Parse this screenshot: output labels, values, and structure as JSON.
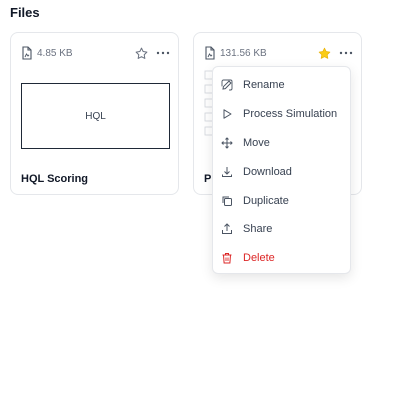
{
  "section_title": "Files",
  "cards": [
    {
      "size": "4.85 KB",
      "preview_text": "HQL",
      "title": "HQL Scoring",
      "starred": false
    },
    {
      "size": "131.56 KB",
      "title_visible": "P",
      "starred": true
    }
  ],
  "menu": {
    "items": [
      {
        "label": "Rename",
        "icon": "pencil-icon"
      },
      {
        "label": "Process Simulation",
        "icon": "play-icon"
      },
      {
        "label": "Move",
        "icon": "move-icon"
      },
      {
        "label": "Download",
        "icon": "download-icon"
      },
      {
        "label": "Duplicate",
        "icon": "duplicate-icon"
      },
      {
        "label": "Share",
        "icon": "share-icon"
      },
      {
        "label": "Delete",
        "icon": "trash-icon"
      }
    ]
  },
  "colors": {
    "star_active": "#facc15",
    "danger": "#dc2626",
    "border": "#e5e7eb"
  }
}
